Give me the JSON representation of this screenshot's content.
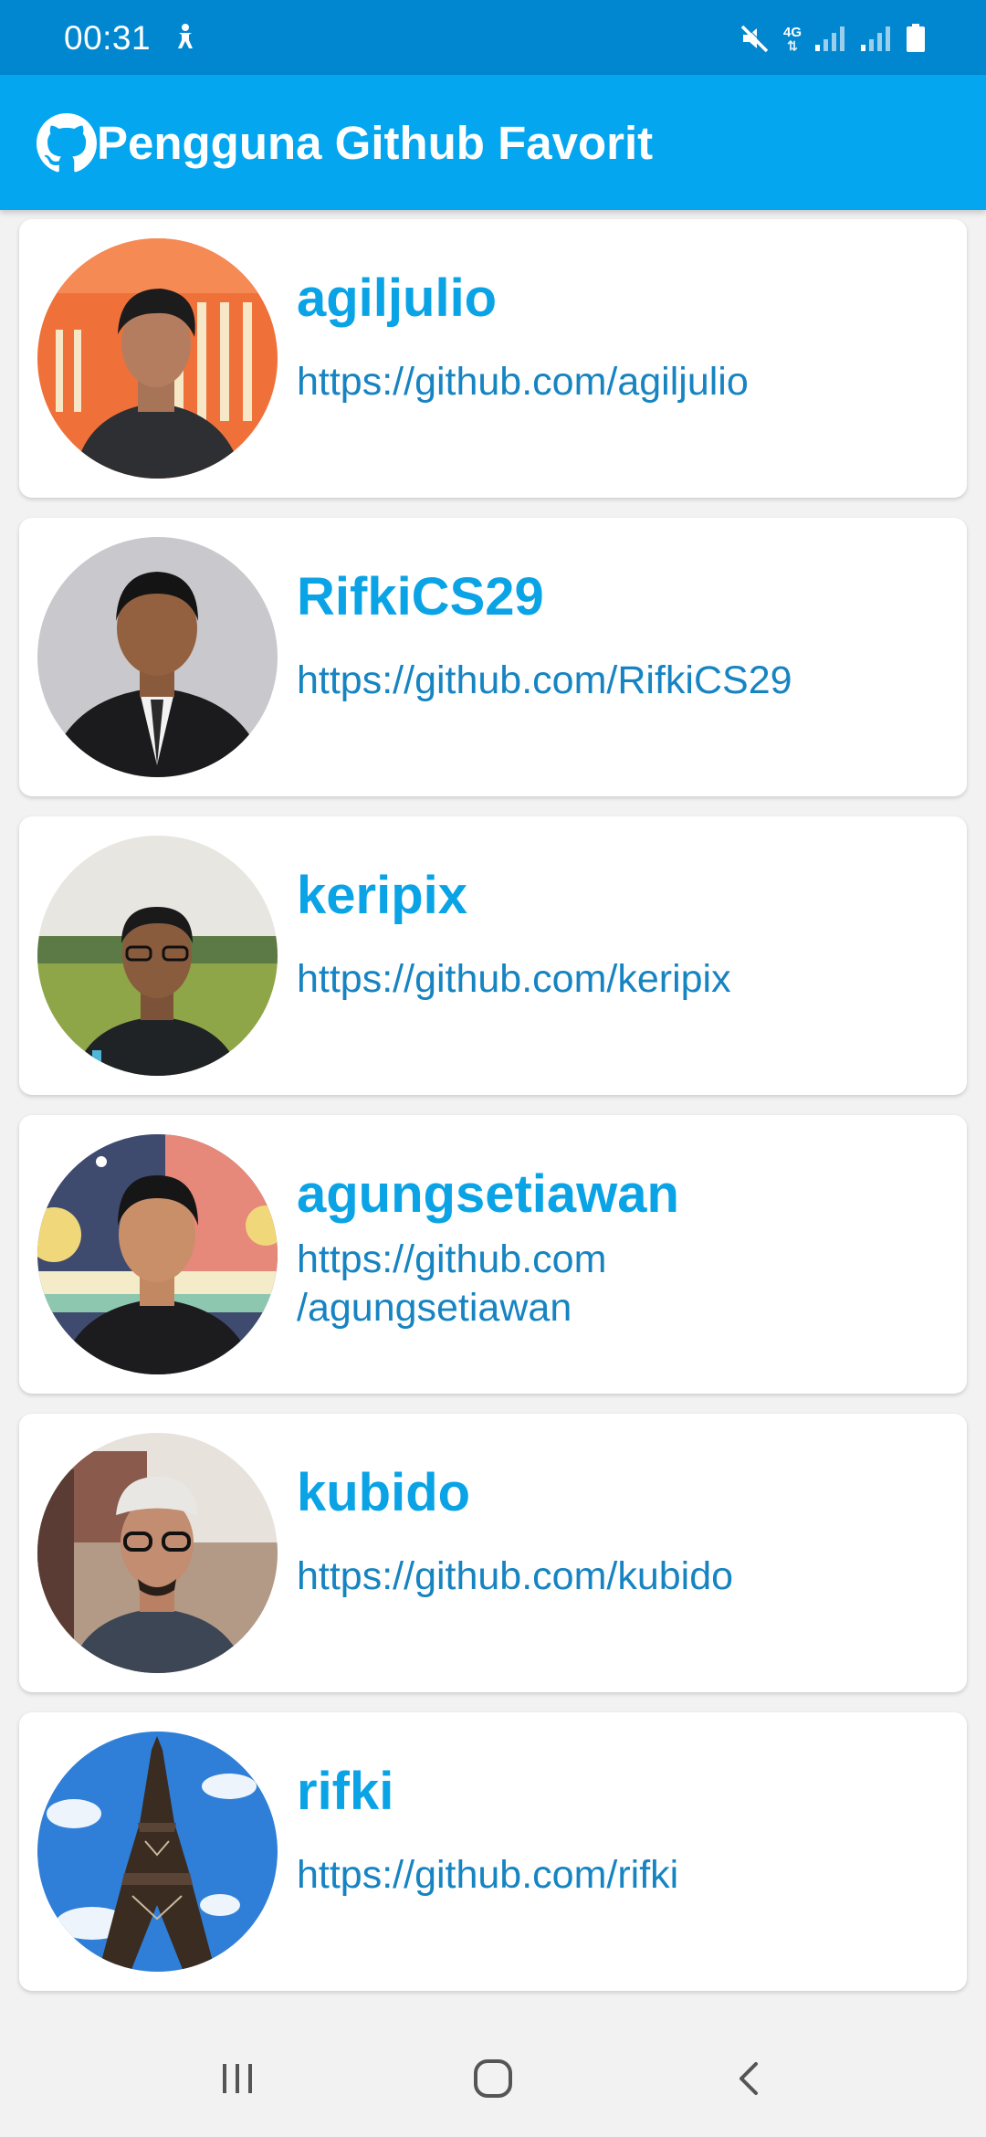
{
  "status_bar": {
    "time": "00:31",
    "network_type": "4G",
    "icons": [
      "accessibility-icon",
      "mute-icon",
      "signal-icon",
      "signal-icon",
      "battery-icon"
    ]
  },
  "app_bar": {
    "title": "Pengguna Github Favorit",
    "logo_icon": "github-icon"
  },
  "users": [
    {
      "username": "agiljulio",
      "url": "https://github.com/agiljulio"
    },
    {
      "username": "RifkiCS29",
      "url": "https://github.com/RifkiCS29"
    },
    {
      "username": "keripix",
      "url": "https://github.com/keripix"
    },
    {
      "username": "agungsetiawan",
      "url": "https://github.com/agungsetiawan"
    },
    {
      "username": "kubido",
      "url": "https://github.com/kubido"
    },
    {
      "username": "rifki",
      "url": "https://github.com/rifki"
    }
  ],
  "nav_bar": {
    "icons": [
      "recent-apps-icon",
      "home-icon",
      "back-icon"
    ]
  },
  "colors": {
    "status_bar": "#0187cf",
    "app_bar": "#04a6ef",
    "username": "#0aa3e6",
    "url": "#1784c2",
    "background": "#f2f2f2"
  }
}
